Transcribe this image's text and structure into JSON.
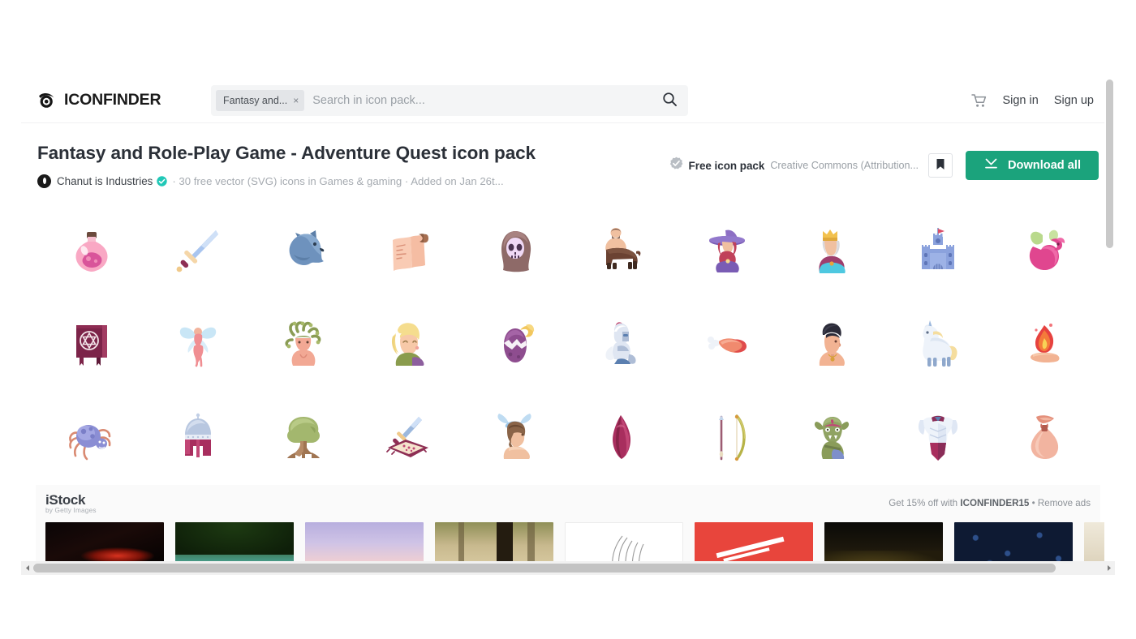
{
  "header": {
    "brand": "ICONFINDER",
    "brand_icon": "iconfinder-eye-logo",
    "search": {
      "chip_label": "Fantasy and...",
      "chip_close": "×",
      "placeholder": "Search in icon pack...",
      "value": "",
      "search_icon": "search-icon"
    },
    "cart_icon": "shopping-cart-icon",
    "sign_in": "Sign in",
    "sign_up": "Sign up"
  },
  "pack": {
    "title": "Fantasy and Role-Play Game - Adventure Quest icon pack",
    "author": "Chanut is Industries",
    "verified_icon": "verified-badge-icon",
    "meta": "· 30 free vector (SVG) icons in Games & gaming · Added on Jan 26t...",
    "license_badge_icon": "license-seal-icon",
    "license_label": "Free icon pack",
    "license_text": "Creative Commons (Attribution...",
    "bookmark_icon": "bookmark-icon",
    "download_icon": "download-arrow-icon",
    "download_label": "Download all"
  },
  "icons": [
    {
      "name": "potion-icon",
      "label": "Potion"
    },
    {
      "name": "sword-icon",
      "label": "Sword"
    },
    {
      "name": "wolf-icon",
      "label": "Wolf"
    },
    {
      "name": "scroll-icon",
      "label": "Scroll"
    },
    {
      "name": "grim-reaper-icon",
      "label": "Grim reaper"
    },
    {
      "name": "centaur-icon",
      "label": "Centaur"
    },
    {
      "name": "witch-icon",
      "label": "Witch"
    },
    {
      "name": "king-icon",
      "label": "King"
    },
    {
      "name": "castle-icon",
      "label": "Castle"
    },
    {
      "name": "dragon-icon",
      "label": "Dragon"
    },
    {
      "name": "spell-book-icon",
      "label": "Spell book"
    },
    {
      "name": "fairy-icon",
      "label": "Fairy"
    },
    {
      "name": "medusa-icon",
      "label": "Medusa"
    },
    {
      "name": "elf-girl-icon",
      "label": "Elf girl"
    },
    {
      "name": "dragon-egg-icon",
      "label": "Dragon egg"
    },
    {
      "name": "knight-icon",
      "label": "Knight"
    },
    {
      "name": "meat-icon",
      "label": "Meat"
    },
    {
      "name": "hero-icon",
      "label": "Hero"
    },
    {
      "name": "unicorn-icon",
      "label": "Unicorn"
    },
    {
      "name": "fire-magic-icon",
      "label": "Fire magic"
    },
    {
      "name": "spider-icon",
      "label": "Spider"
    },
    {
      "name": "helmet-icon",
      "label": "Helmet"
    },
    {
      "name": "tree-icon",
      "label": "Tree"
    },
    {
      "name": "magic-carpet-icon",
      "label": "Magic carpet"
    },
    {
      "name": "barbarian-icon",
      "label": "Barbarian"
    },
    {
      "name": "crystal-icon",
      "label": "Crystal"
    },
    {
      "name": "bow-icon",
      "label": "Bow"
    },
    {
      "name": "orc-icon",
      "label": "Orc"
    },
    {
      "name": "armor-icon",
      "label": "Armor"
    },
    {
      "name": "money-bag-icon",
      "label": "Money bag"
    }
  ],
  "ad": {
    "logo_name": "iStock",
    "logo_sub": "by Getty Images",
    "promo_prefix": "Get 15% off with ",
    "promo_code": "ICONFINDER15",
    "promo_sep": " • ",
    "promo_remove": "Remove ads"
  },
  "scrollbars": {
    "vertical_name": "vertical-scrollbar",
    "horizontal_name": "horizontal-scrollbar"
  },
  "colors": {
    "accent_green": "#1ba37c",
    "chip_bg": "#e3e5e8",
    "search_bg": "#f4f5f6",
    "text_dark": "#2b3038",
    "text_muted": "#9aa0a6"
  }
}
